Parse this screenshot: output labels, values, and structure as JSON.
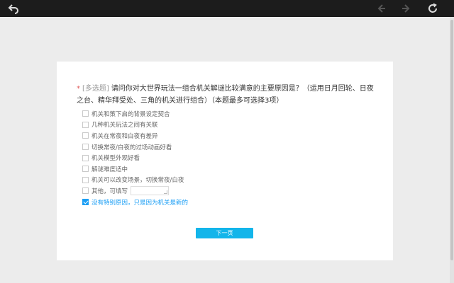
{
  "toolbar": {
    "back_icon": "undo-arrow-icon",
    "prev_icon": "prev-arrow-icon",
    "next_icon": "next-arrow-icon",
    "refresh_icon": "refresh-icon"
  },
  "question": {
    "required_mark": "*",
    "type_label": "[多选题]",
    "text": "请问你对大世界玩法一组合机关解谜比较满意的主要原因是？（运用日月回轮、日夜之台、精华拜受处、三角的机关进行组合）（本题最多可选择3项）"
  },
  "options": [
    {
      "label": "机关和策下启的背景设定契合",
      "checked": false
    },
    {
      "label": "几种机关玩法之间有关联",
      "checked": false
    },
    {
      "label": "机关在常夜和白夜有差异",
      "checked": false
    },
    {
      "label": "切换常夜/白夜的过场动画好看",
      "checked": false
    },
    {
      "label": "机关模型外观好看",
      "checked": false
    },
    {
      "label": "解谜难度适中",
      "checked": false
    },
    {
      "label": "机关可以改变场景，切换常夜/白夜",
      "checked": false
    },
    {
      "label": "其他，可填写",
      "checked": false,
      "has_input": true,
      "input_value": ""
    },
    {
      "label": "没有特别原因，只是因为机关是新的",
      "checked": true
    }
  ],
  "next_button": {
    "label": "下一页"
  },
  "colors": {
    "accent": "#13b5ea",
    "checked": "#1a9ef5",
    "required": "#e05c5c"
  }
}
